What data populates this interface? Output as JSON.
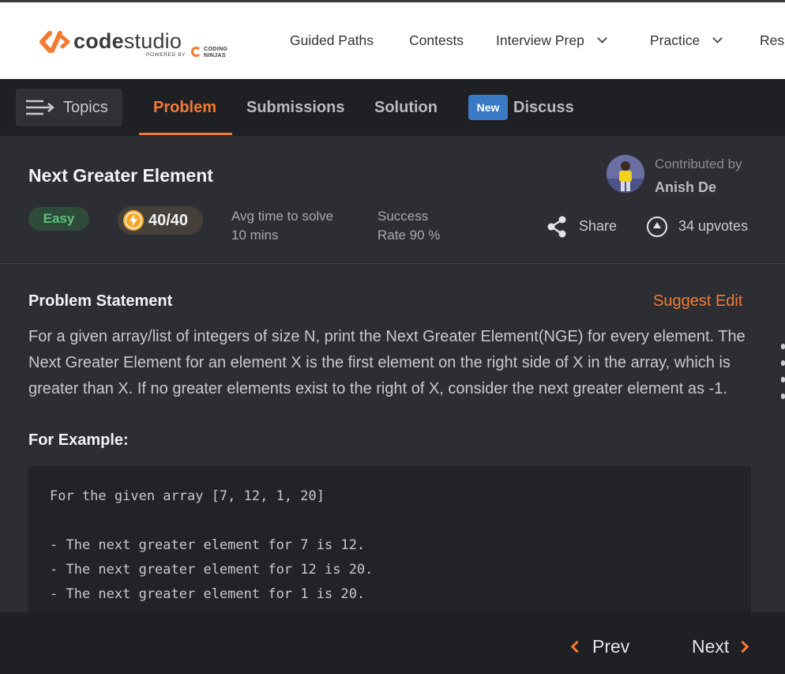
{
  "brand": {
    "name_bold": "code",
    "name_light": "studio",
    "powered_by": "POWERED BY",
    "partner_line1": "CODING",
    "partner_line2": "NINJAS",
    "accent": "#f47a33"
  },
  "nav": {
    "items": [
      {
        "label": "Guided Paths",
        "has_dropdown": false
      },
      {
        "label": "Contests",
        "has_dropdown": false
      },
      {
        "label": "Interview Prep",
        "has_dropdown": true
      },
      {
        "label": "Practice",
        "has_dropdown": true
      },
      {
        "label": "Res",
        "has_dropdown": false
      }
    ]
  },
  "tabs": {
    "topics_label": "Topics",
    "items": [
      {
        "label": "Problem",
        "active": true
      },
      {
        "label": "Submissions",
        "active": false
      },
      {
        "label": "Solution",
        "active": false
      },
      {
        "label": "Discuss",
        "active": false,
        "badge": "New"
      }
    ]
  },
  "problem": {
    "title": "Next Greater Element",
    "difficulty": "Easy",
    "score": "40/40",
    "avg_time_label": "Avg time to solve",
    "avg_time_value": "10 mins",
    "success_label": "Success",
    "success_value": "Rate 90 %",
    "contributed_by_label": "Contributed by",
    "contributor": "Anish De",
    "share_label": "Share",
    "upvotes_label": "34 upvotes"
  },
  "statement": {
    "heading": "Problem Statement",
    "suggest_edit": "Suggest Edit",
    "body": "For a given array/list of integers of size N, print the Next Greater Element(NGE) for every element. The Next Greater Element for an element X is the first element on the right side of X in the array, which is greater than X. If no greater elements exist to the right of X, consider the next greater element as -1.",
    "example_heading": "For Example:",
    "code_lines": [
      "For the given array [7, 12, 1, 20]",
      "- The next greater element for 7 is 12.",
      "- The next greater element for 12 is 20.",
      "- The next greater element for 1 is 20."
    ]
  },
  "footer": {
    "prev_label": "Prev",
    "next_label": "Next"
  }
}
